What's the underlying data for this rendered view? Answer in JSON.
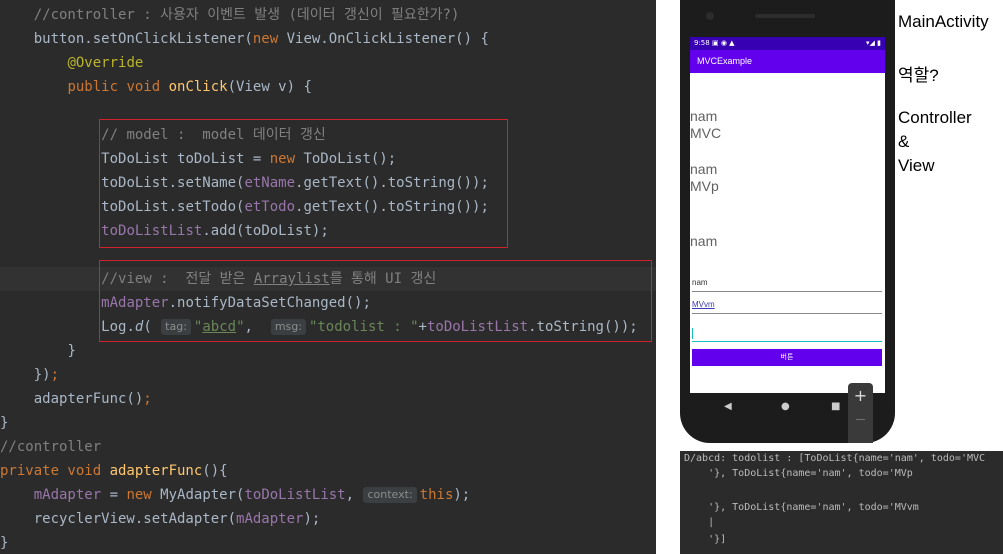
{
  "code": {
    "l1": "//controller : 사용자 이벤트 발생 (데이터 갱신이 필요한가?)",
    "l2_obj": "button.setOnClickListener(",
    "l2_new": "new ",
    "l2_rest": "View.OnClickListener() {",
    "l3": "@Override",
    "l4_kw": "public void ",
    "l4_fn": "onClick",
    "l4_rest": "(View v) {",
    "l5": "// model :  model 데이터 갱신",
    "l6_a": "ToDoList toDoList = ",
    "l6_new": "new ",
    "l6_b": "ToDoList();",
    "l7_a": "toDoList.setName(",
    "l7_f": "etName",
    "l7_b": ".getText().toString());",
    "l8_a": "toDoList.setTodo(",
    "l8_f": "etTodo",
    "l8_b": ".getText().toString());",
    "l9_f": "toDoListList",
    "l9_b": ".add(toDoList);",
    "l10_a": "//view :  전달 받은 ",
    "l10_u": "Arraylist",
    "l10_b": "를 통해 UI 갱신",
    "l11_f": "mAdapter",
    "l11_b": ".notifyDataSetChanged();",
    "l12_a": "Log.",
    "l12_d": "d",
    "l12_p": "( ",
    "l12_hint1": "tag:",
    "l12_s1q1": "\"",
    "l12_s1": "abcd",
    "l12_s1q2": "\"",
    "l12_comma": ",  ",
    "l12_hint2": "msg:",
    "l12_s2": "\"todolist : \"",
    "l12_plus": "+",
    "l12_f": "toDoListList",
    "l12_end": ".toString());",
    "l13": "}",
    "l14_a": "})",
    "l14_b": ";",
    "l15_a": "adapterFunc()",
    "l15_b": ";",
    "l16": "}",
    "l17": "//controller",
    "l18_kw": "private void ",
    "l18_fn": "adapterFunc",
    "l18_rest": "(){",
    "l19_f": "mAdapter",
    "l19_a": " = ",
    "l19_new": "new ",
    "l19_b": "MyAdapter(",
    "l19_f2": "toDoListList",
    "l19_c": ", ",
    "l19_hint": "context:",
    "l19_this": "this",
    "l19_end": ");",
    "l20_a": "recyclerView.setAdapter(",
    "l20_f": "mAdapter",
    "l20_b": ");",
    "l21": "}"
  },
  "phone": {
    "status_time": "9:58",
    "status_right": "▾◢ ▮",
    "app_title": "MVCExample",
    "items": [
      {
        "name": "nam",
        "todo": "MVC"
      },
      {
        "name": "nam",
        "todo": "MVp"
      },
      {
        "name": "nam",
        "todo": ""
      }
    ],
    "name_field": "nam",
    "todo_field": "MVvm",
    "button_label": "버튼",
    "fab_plus": "+",
    "fab_minus": "—"
  },
  "notes": {
    "activity": "MainActivity",
    "role": "역할?",
    "controller": "Controller",
    "amp": "&",
    "view": "View"
  },
  "console": {
    "line1": "D/abcd: todolist : [ToDoList{name='nam', todo='MVC",
    "line2": "    '}, ToDoList{name='nam', todo='MVp",
    "line3": "    '}, ToDoList{name='nam', todo='MVvm",
    "line4": "    |",
    "line5": "    '}]"
  },
  "colors": {
    "editor_bg": "#2b2b2b",
    "highlight_box": "#d0222a",
    "app_primary": "#6200ee",
    "status_bar": "#3700b3",
    "focus_underline": "#16bfc1"
  }
}
